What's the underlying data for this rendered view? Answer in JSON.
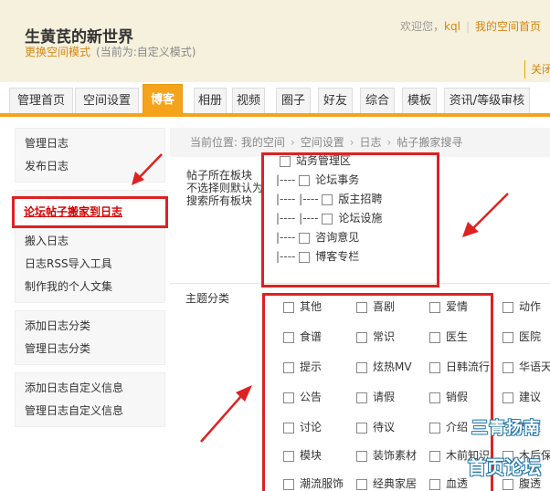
{
  "header": {
    "site_title": "生黄芪的新世界",
    "mode_link": "更换空间模式",
    "mode_current": "(当前为:自定义模式)",
    "welcome": "欢迎您，",
    "username": "kql",
    "my_space": "我的空间首页",
    "follow": "关闭"
  },
  "nav": {
    "tabs": [
      "管理首页",
      "空间设置",
      "博客",
      "相册",
      "视频",
      "圈子",
      "好友",
      "综合",
      "模板",
      "资讯/等级审核"
    ],
    "active": "博客"
  },
  "sidebar": {
    "groups": [
      {
        "items": [
          "管理日志",
          "发布日志"
        ]
      },
      {
        "items": [
          "论坛帖子搬家到日志",
          "搬入日志",
          "日志RSS导入工具",
          "制作我的个人文集"
        ]
      },
      {
        "items": [
          "添加日志分类",
          "管理日志分类"
        ]
      },
      {
        "items": [
          "添加日志自定义信息",
          "管理日志自定义信息"
        ]
      }
    ],
    "highlighted": "论坛帖子搬家到日志"
  },
  "breadcrumb": {
    "prefix": "当前位置:",
    "items": [
      "我的空间",
      "空间设置",
      "日志",
      "帖子搬家搜寻"
    ]
  },
  "board_section": {
    "label_lines": [
      "帖子所在板块",
      "不选择则默认为",
      "搜索所有板块"
    ],
    "boards": [
      {
        "prefix": "",
        "name": "站务管理区"
      },
      {
        "prefix": "|----",
        "name": "论坛事务"
      },
      {
        "prefix": "|---- |----",
        "name": "版主招聘"
      },
      {
        "prefix": "|---- |----",
        "name": "论坛设施"
      },
      {
        "prefix": "|----",
        "name": "咨询意见"
      },
      {
        "prefix": "|----",
        "name": "博客专栏"
      }
    ]
  },
  "topic_section": {
    "label": "主题分类",
    "columns": [
      [
        "其他",
        "食谱",
        "提示",
        "公告",
        "讨论",
        "模块",
        "潮流服饰"
      ],
      [
        "喜剧",
        "常识",
        "炫热MV",
        "请假",
        "待议",
        "装饰素材",
        "经典家居"
      ],
      [
        "爱情",
        "医生",
        "日韩流行",
        "销假",
        "介绍",
        "木前知识",
        "血透"
      ],
      [
        "动作",
        "医院",
        "华语天",
        "建议",
        "改建",
        "木后保",
        "腹透"
      ]
    ]
  },
  "watermark": {
    "line1": "三青扬南",
    "line2": "首页论坛"
  },
  "colors": {
    "accent": "#f5a31a",
    "link": "#d58512",
    "annotation_red": "#d22"
  }
}
